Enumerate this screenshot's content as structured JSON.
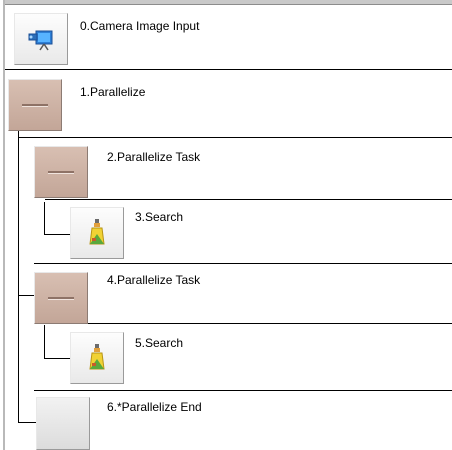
{
  "flow_items": [
    {
      "label": "0.Camera Image Input",
      "icon": "camera-icon"
    },
    {
      "label": "1.Parallelize",
      "icon": "parallelize-icon"
    },
    {
      "label": "2.Parallelize Task",
      "icon": "parallelize-task-icon"
    },
    {
      "label": "3.Search",
      "icon": "search-icon"
    },
    {
      "label": "4.Parallelize Task",
      "icon": "parallelize-task-icon"
    },
    {
      "label": "5.Search",
      "icon": "search-icon"
    },
    {
      "label": "6.*Parallelize End",
      "icon": "parallelize-end-icon"
    }
  ],
  "colors": {
    "unit_brown": "#c9ab9d",
    "separator": "#000000"
  }
}
